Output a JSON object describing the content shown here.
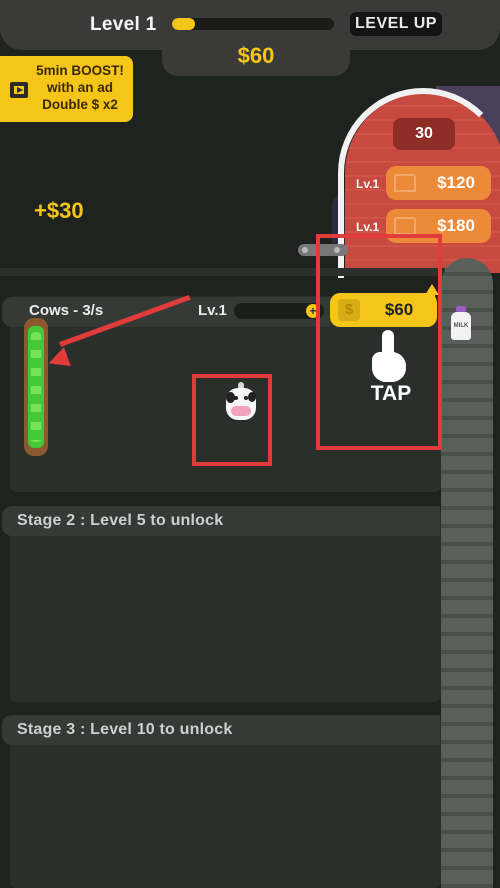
{
  "hud": {
    "level_label": "Level 1",
    "xp_progress": 0.14,
    "level_up_label": "LEVEL UP",
    "money": "$60"
  },
  "boost": {
    "line1": "5min BOOST!",
    "line2": "with an ad",
    "line3": "Double $ x2"
  },
  "floating_income": "+$30",
  "barn": {
    "capacity": "30",
    "upgrades": [
      {
        "level": "Lv.1",
        "price": "$120"
      },
      {
        "level": "Lv.1",
        "price": "$180"
      }
    ]
  },
  "milk_bottle_label": "MILK",
  "stage1": {
    "rate": "Cows - 3/s",
    "level": "Lv.1",
    "buy_price": "$60",
    "buy_currency_icon": "$",
    "tap_label": "TAP"
  },
  "locked_stages": [
    {
      "title": "Stage 2 : Level 5 to unlock"
    },
    {
      "title": "Stage 3 : Level 10 to unlock"
    }
  ],
  "colors": {
    "accent_yellow": "#f5c518",
    "barn_red": "#c8493f",
    "upgrade_orange": "#ec8a3a",
    "highlight_red": "#e23b3b",
    "milk_green": "#43c93a"
  }
}
